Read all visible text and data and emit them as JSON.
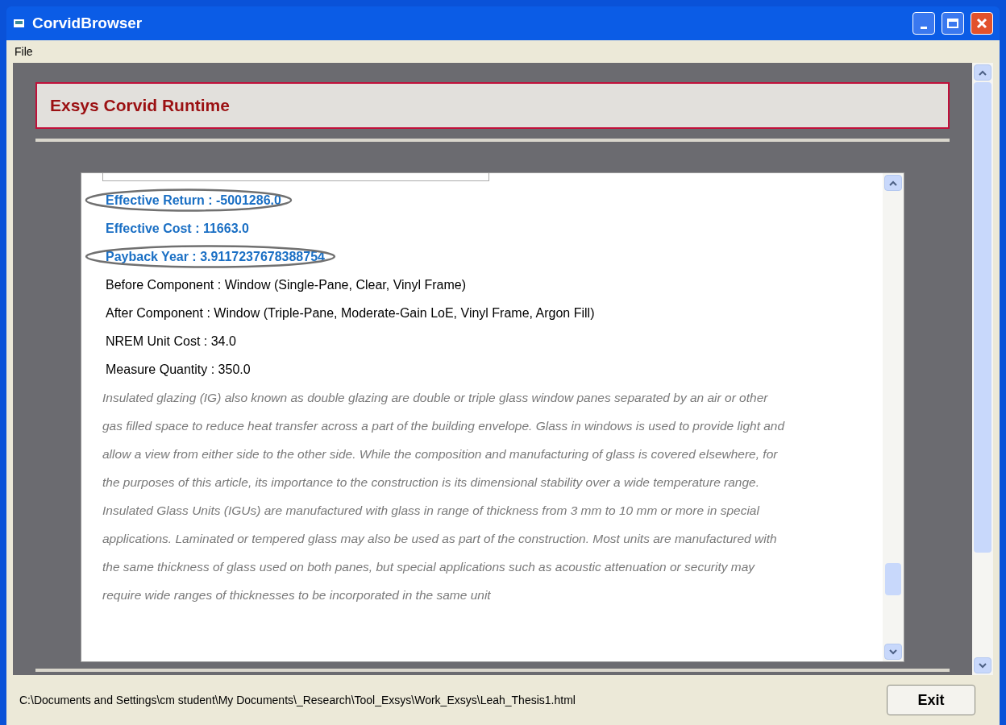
{
  "window": {
    "title": "CorvidBrowser"
  },
  "menu": [
    "File"
  ],
  "header": {
    "title": "Exsys Corvid Runtime"
  },
  "results": [
    {
      "kind": "result",
      "text": "Effective Return : -5001286.0",
      "circled": true
    },
    {
      "kind": "result",
      "text": "Effective Cost : 11663.0",
      "circled": false
    },
    {
      "kind": "result",
      "text": "Payback Year : 3.9117237678388754",
      "circled": true
    },
    {
      "kind": "detail",
      "text": "Before Component : Window (Single-Pane, Clear, Vinyl Frame)",
      "circled": false
    },
    {
      "kind": "detail",
      "text": "After Component : Window (Triple-Pane, Moderate-Gain LoE, Vinyl Frame, Argon Fill)",
      "circled": false
    },
    {
      "kind": "detail",
      "text": "NREM Unit Cost : 34.0",
      "circled": false
    },
    {
      "kind": "detail",
      "text": "Measure Quantity : 350.0",
      "circled": false
    },
    {
      "kind": "description",
      "text": "Insulated glazing (IG) also known as double glazing are double or triple glass window panes separated by an air or other gas filled space to reduce heat transfer across a part of the building envelope. Glass in windows is used to provide light and allow a view from either side to the other side. While the composition and manufacturing of glass is covered elsewhere, for the purposes of this article, its importance to the construction is its dimensional stability over a wide temperature range. Insulated Glass Units (IGUs) are manufactured with glass in range of thickness from 3 mm to 10 mm or more in special applications. Laminated or tempered glass may also be used as part of the construction. Most units are manufactured with the same thickness of glass used on both panes, but special applications such as acoustic attenuation or security may require wide ranges of thicknesses to be incorporated in the same unit",
      "circled": false
    }
  ],
  "status_bar": {
    "path": "C:\\Documents and Settings\\cm student\\My Documents\\_Research\\Tool_Exsys\\Work_Exsys\\Leah_Thesis1.html",
    "button": "Exit"
  }
}
